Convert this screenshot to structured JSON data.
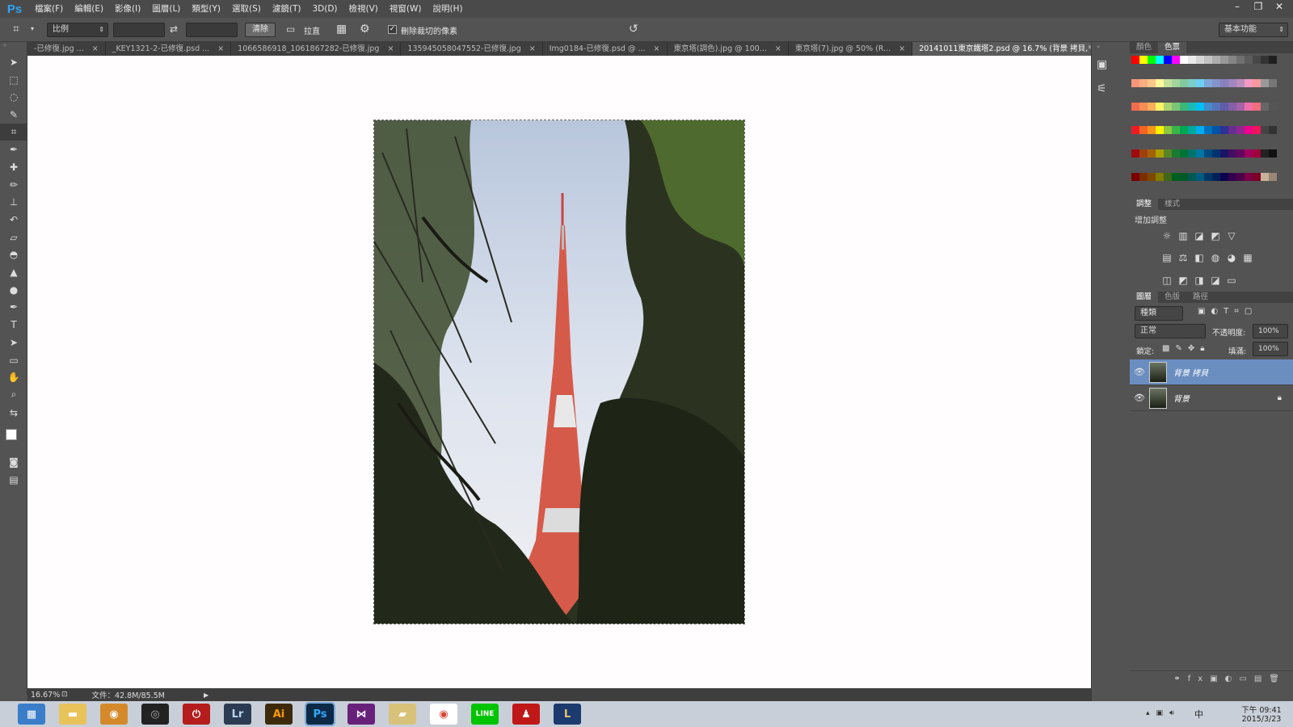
{
  "menubar": {
    "logo": "Ps",
    "items": [
      "檔案(F)",
      "編輯(E)",
      "影像(I)",
      "圖層(L)",
      "類型(Y)",
      "選取(S)",
      "濾鏡(T)",
      "3D(D)",
      "檢視(V)",
      "視窗(W)",
      "說明(H)"
    ]
  },
  "options": {
    "ratio_label": "比例",
    "clear_label": "清除",
    "straighten_label": "拉直",
    "delete_cropped_label": "刪除裁切的像素",
    "delete_cropped_checked": true,
    "workspace": "基本功能"
  },
  "tabs": [
    {
      "label": "-已修復.jpg ...",
      "active": false
    },
    {
      "label": "_KEY1321-2-已修復.psd ...",
      "active": false
    },
    {
      "label": "1066586918_1061867282-已修復.jpg",
      "active": false
    },
    {
      "label": "135945058047552-已修復.jpg",
      "active": false
    },
    {
      "label": "Img0184-已修復.psd @ ...",
      "active": false
    },
    {
      "label": "東京塔(調色).jpg @ 100...",
      "active": false
    },
    {
      "label": "東京塔(7).jpg @ 50% (R...",
      "active": false
    },
    {
      "label": "20141011東京鐵塔2.psd @ 16.7% (背景 拷貝, RGB/8) *",
      "active": true
    }
  ],
  "status": {
    "zoom": "16.67%",
    "doc_size": "文件：42.8M/85.5M"
  },
  "panels": {
    "color_tabs": [
      "顏色",
      "色票"
    ],
    "adjust_tabs": [
      "調整",
      "樣式"
    ],
    "adjust_title": "增加調整",
    "layers_tabs": [
      "圖層",
      "色版",
      "路徑"
    ],
    "kind_filter": "種類",
    "blend_mode": "正常",
    "opacity_label": "不透明度:",
    "opacity_value": "100%",
    "lock_label": "鎖定:",
    "fill_label": "填滿:",
    "fill_value": "100%",
    "layers": [
      {
        "name": "背景 拷貝",
        "selected": true,
        "locked": false
      },
      {
        "name": "背景",
        "selected": false,
        "locked": true
      }
    ]
  },
  "taskbar": {
    "apps": [
      "explorer",
      "file-explorer",
      "app-orange",
      "webcam",
      "power",
      "Lr",
      "Ai",
      "Ps",
      "vs",
      "folder",
      "chrome",
      "LINE",
      "app-red",
      "L"
    ],
    "time": "下午 09:41",
    "date": "2015/3/23",
    "ime": "中"
  },
  "swatch_colors": [
    "#ff0000",
    "#ffff00",
    "#00ff00",
    "#00ffff",
    "#0000ff",
    "#ff00ff",
    "#ffffff",
    "#ebebeb",
    "#d6d6d6",
    "#c2c2c2",
    "#adadad",
    "#999999",
    "#858585",
    "#707070",
    "#5c5c5c",
    "#474747",
    "#333333",
    "#1f1f1f",
    "#000000",
    "#ff0000",
    "#ffff66"
  ]
}
